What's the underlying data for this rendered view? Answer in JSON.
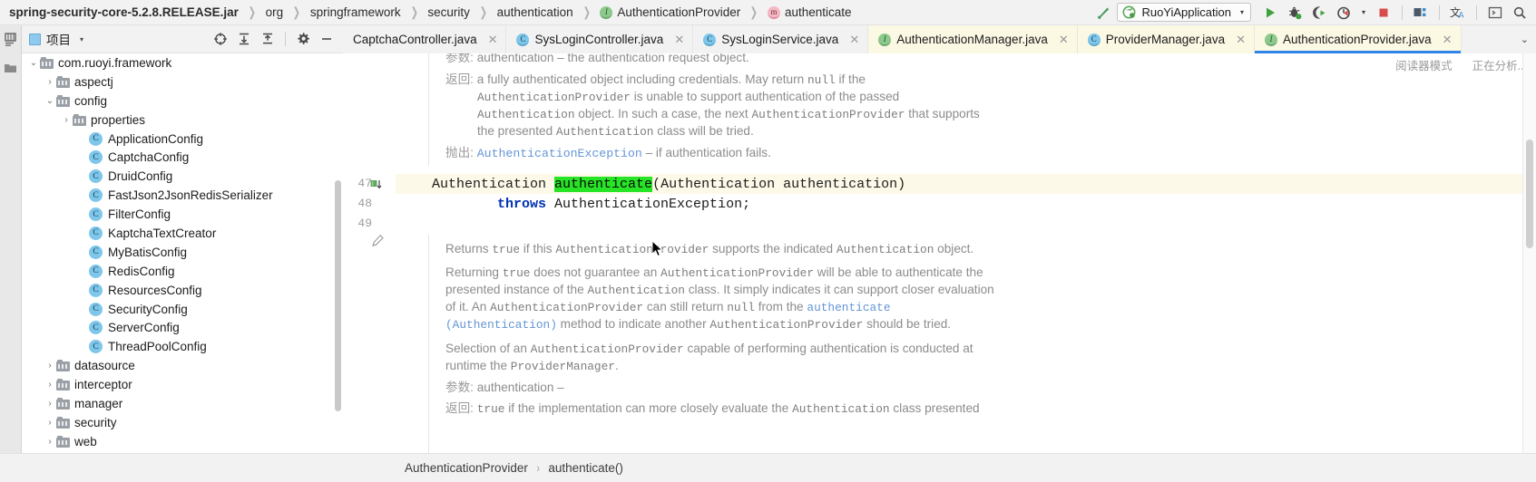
{
  "breadcrumb": {
    "items": [
      {
        "label": "spring-security-core-5.2.8.RELEASE.jar",
        "icon": "",
        "bold": true
      },
      {
        "label": "org",
        "icon": ""
      },
      {
        "label": "springframework",
        "icon": ""
      },
      {
        "label": "security",
        "icon": ""
      },
      {
        "label": "authentication",
        "icon": ""
      },
      {
        "label": "AuthenticationProvider",
        "icon": "interface-icon"
      },
      {
        "label": "authenticate",
        "icon": "method-icon"
      }
    ]
  },
  "toolbar": {
    "hammer_icon": "build-hammer-icon",
    "run_config": "RuoYiApplication",
    "run_config_caret": "▾",
    "run_icon": "run-icon",
    "debug_icon": "debug-icon",
    "run_coverage_icon": "run-with-coverage-icon",
    "profiler_icon": "profiler-icon",
    "profiler_caret": "▾",
    "stop_icon": "stop-icon",
    "services_icon": "services-icon",
    "translate_icon": "translate-icon",
    "terminal_icon": "terminal-icon",
    "search_icon": "search-icon"
  },
  "project_panel": {
    "title": "项目",
    "caret": "▾",
    "icons": {
      "locate": "locate-target-icon",
      "expand": "expand-all-icon",
      "collapse": "collapse-all-icon",
      "settings": "gear-icon",
      "hide": "minimize-icon"
    }
  },
  "left_rail": {
    "items": [
      {
        "label": "",
        "icon": "structure-icon"
      },
      {
        "label": "",
        "icon": "project-folder-icon"
      }
    ]
  },
  "tree": {
    "nodes": [
      {
        "label": "com.ruoyi.framework",
        "icon": "package-icon",
        "arrow": "down",
        "indent": 1
      },
      {
        "label": "aspectj",
        "icon": "package-icon",
        "arrow": "right",
        "indent": 2
      },
      {
        "label": "config",
        "icon": "package-icon",
        "arrow": "down",
        "indent": 2
      },
      {
        "label": "properties",
        "icon": "package-icon",
        "arrow": "right",
        "indent": 3
      },
      {
        "label": "ApplicationConfig",
        "icon": "class-icon",
        "arrow": "",
        "indent": 4
      },
      {
        "label": "CaptchaConfig",
        "icon": "class-icon",
        "arrow": "",
        "indent": 4
      },
      {
        "label": "DruidConfig",
        "icon": "class-icon",
        "arrow": "",
        "indent": 4
      },
      {
        "label": "FastJson2JsonRedisSerializer",
        "icon": "class-icon",
        "arrow": "",
        "indent": 4
      },
      {
        "label": "FilterConfig",
        "icon": "class-icon",
        "arrow": "",
        "indent": 4
      },
      {
        "label": "KaptchaTextCreator",
        "icon": "class-icon",
        "arrow": "",
        "indent": 4
      },
      {
        "label": "MyBatisConfig",
        "icon": "class-icon",
        "arrow": "",
        "indent": 4
      },
      {
        "label": "RedisConfig",
        "icon": "class-icon",
        "arrow": "",
        "indent": 4
      },
      {
        "label": "ResourcesConfig",
        "icon": "class-icon",
        "arrow": "",
        "indent": 4
      },
      {
        "label": "SecurityConfig",
        "icon": "class-icon",
        "arrow": "",
        "indent": 4
      },
      {
        "label": "ServerConfig",
        "icon": "class-icon",
        "arrow": "",
        "indent": 4
      },
      {
        "label": "ThreadPoolConfig",
        "icon": "class-icon",
        "arrow": "",
        "indent": 4
      },
      {
        "label": "datasource",
        "icon": "package-icon",
        "arrow": "right",
        "indent": 2
      },
      {
        "label": "interceptor",
        "icon": "package-icon",
        "arrow": "right",
        "indent": 2
      },
      {
        "label": "manager",
        "icon": "package-icon",
        "arrow": "right",
        "indent": 2
      },
      {
        "label": "security",
        "icon": "package-icon",
        "arrow": "right",
        "indent": 2
      },
      {
        "label": "web",
        "icon": "package-icon",
        "arrow": "right",
        "indent": 2
      }
    ]
  },
  "tabs": [
    {
      "label": "CaptchaController.java",
      "icon": "",
      "state": "normal",
      "close": "✕"
    },
    {
      "label": "SysLoginController.java",
      "icon": "class-icon",
      "state": "normal",
      "close": "✕"
    },
    {
      "label": "SysLoginService.java",
      "icon": "class-icon",
      "state": "normal",
      "close": "✕"
    },
    {
      "label": "AuthenticationManager.java",
      "icon": "interface-icon",
      "state": "library",
      "close": "✕"
    },
    {
      "label": "ProviderManager.java",
      "icon": "class-icon",
      "state": "library",
      "close": "✕"
    },
    {
      "label": "AuthenticationProvider.java",
      "icon": "interface-icon",
      "state": "active",
      "close": "✕"
    }
  ],
  "tabs_overflow_icon": "chevron-down-icon",
  "editor": {
    "status_right": [
      "阅读器模式",
      "正在分析..."
    ],
    "gutter_lines": [
      "47",
      "48",
      "49"
    ],
    "gutter_marker_icon": "implementing-method-icon",
    "doc_top": [
      {
        "label": "参数:",
        "text": "authentication – the authentication request object."
      },
      {
        "label": "返回:",
        "text": "a fully authenticated object including credentials. May return null if the"
      },
      {
        "label": "",
        "text": "AuthenticationProvider is unable to support authentication of the passed"
      },
      {
        "label": "",
        "text": "Authentication object. In such a case, the next AuthenticationProvider that supports"
      },
      {
        "label": "",
        "text": "the presented Authentication class will be tried."
      },
      {
        "label": "抛出:",
        "text": "AuthenticationException – if authentication fails."
      }
    ],
    "code_lines": [
      {
        "number": "47",
        "text": "Authentication authenticate(Authentication authentication)",
        "highlight_token": "authenticate"
      },
      {
        "number": "48",
        "text": "        throws AuthenticationException;",
        "highlight_token": ""
      },
      {
        "number": "49",
        "text": "",
        "highlight_token": ""
      }
    ],
    "doc_bottom": [
      "Returns true if this AuthenticationProvider supports the indicated Authentication object.",
      "Returning true does not guarantee an AuthenticationProvider will be able to authenticate the",
      "presented instance of the Authentication class. It simply indicates it can support closer evaluation",
      "of it. An AuthenticationProvider can still return null from the authenticate",
      "(Authentication) method to indicate another AuthenticationProvider should be tried.",
      "Selection of an AuthenticationProvider capable of performing authentication is conducted at",
      "runtime the ProviderManager."
    ],
    "doc_bottom_params": [
      {
        "label": "参数:",
        "text": "authentication –"
      },
      {
        "label": "返回:",
        "text": "true if the implementation can more closely evaluate the Authentication class presented"
      }
    ]
  },
  "status_breadcrumb": {
    "items": [
      "AuthenticationProvider",
      "authenticate()"
    ],
    "separator": "›"
  },
  "colors": {
    "accent_blue": "#2f86e8",
    "highlight_green": "#27e427",
    "library_tab_bg": "#fbf8e3",
    "keyword_blue": "#0033b3",
    "doc_text": "#8c8c8c",
    "link_blue": "#6495d6"
  }
}
